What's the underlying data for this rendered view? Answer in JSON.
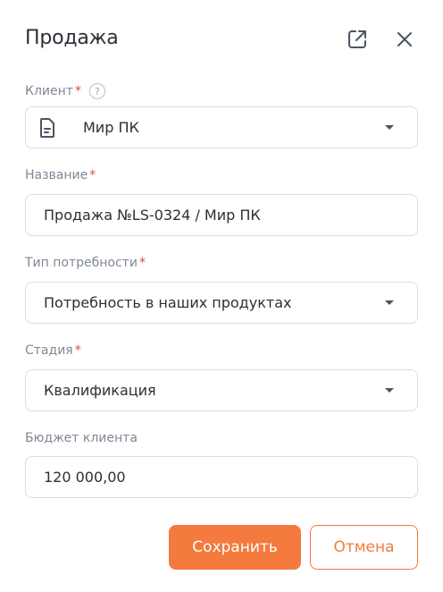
{
  "dialog": {
    "title": "Продажа",
    "open_icon": "open-external-icon",
    "close_icon": "close-icon"
  },
  "form": {
    "client": {
      "label": "Клиент",
      "required_mark": "*",
      "help": "?",
      "value": "Мир ПК",
      "icon": "document-icon"
    },
    "name": {
      "label": "Название",
      "required_mark": "*",
      "value": "Продажа №LS-0324 / Мир ПК"
    },
    "need_type": {
      "label": "Тип потребности",
      "required_mark": "*",
      "value": "Потребность в наших продуктах"
    },
    "stage": {
      "label": "Стадия",
      "required_mark": "*",
      "value": "Квалификация"
    },
    "budget": {
      "label": "Бюджет клиента",
      "value": "120 000,00"
    }
  },
  "actions": {
    "save": "Сохранить",
    "cancel": "Отмена"
  },
  "colors": {
    "accent": "#f47a3d",
    "required": "#e0473f",
    "label": "#7f8896",
    "border": "#d9dde3"
  }
}
